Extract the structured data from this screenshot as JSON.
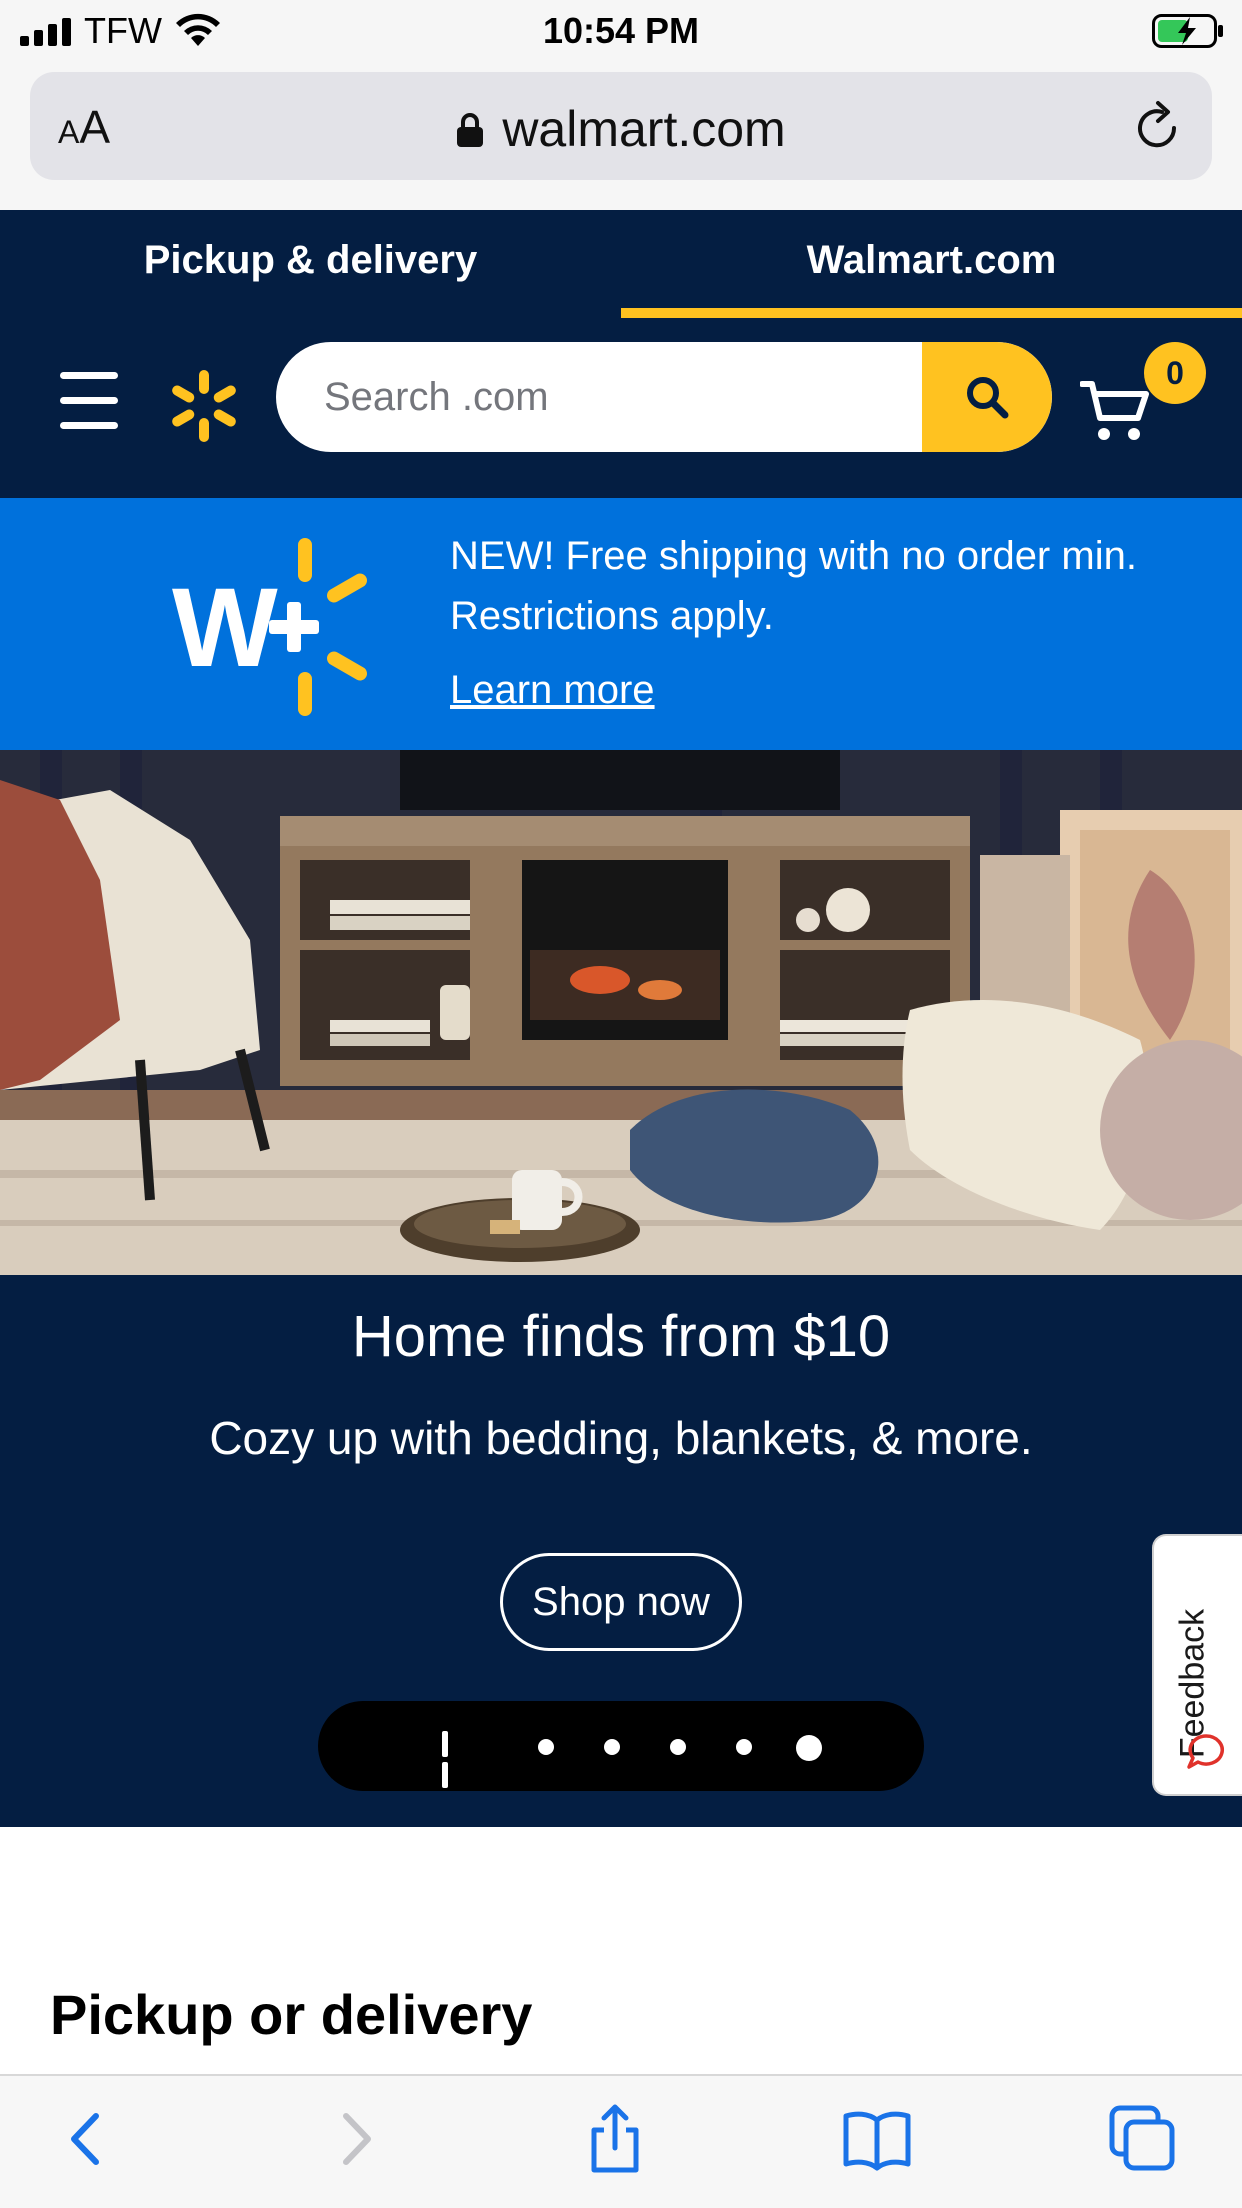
{
  "status_bar": {
    "carrier": "TFW",
    "time": "10:54 PM"
  },
  "browser": {
    "text_size_label": "AA",
    "url": "walmart.com"
  },
  "header": {
    "tabs": [
      {
        "label": "Pickup & delivery"
      },
      {
        "label": "Walmart.com"
      }
    ],
    "active_tab": "Walmart.com",
    "search_placeholder": "Search .com",
    "cart_count": "0"
  },
  "promo": {
    "text": "NEW! Free shipping with no order min. Restrictions apply.",
    "link": "Learn more"
  },
  "hero": {
    "title": "Home finds from $10",
    "subtitle": "Cozy up with bedding, blankets, & more.",
    "cta": "Shop now",
    "slide_count": 5,
    "active_slide": 5
  },
  "feedback": {
    "label": "Feedback"
  },
  "section": {
    "title": "Pickup or delivery"
  },
  "colors": {
    "navy": "#041e42",
    "yellow": "#ffc220",
    "blue": "#0071dc",
    "safari_blue": "#1a73e8"
  }
}
